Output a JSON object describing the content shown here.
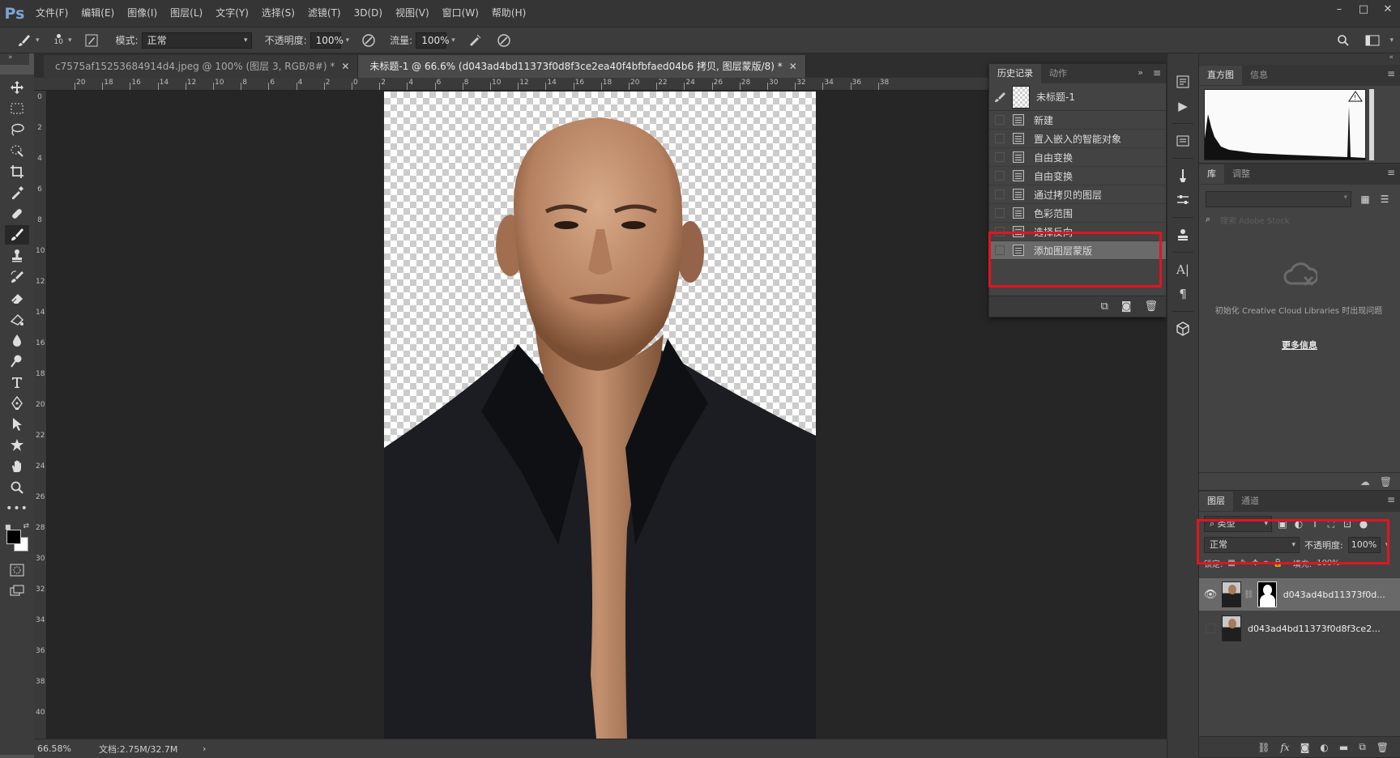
{
  "app": {
    "logo": "Ps",
    "menu": [
      "文件(F)",
      "编辑(E)",
      "图像(I)",
      "图层(L)",
      "文字(Y)",
      "选择(S)",
      "滤镜(T)",
      "3D(D)",
      "视图(V)",
      "窗口(W)",
      "帮助(H)"
    ],
    "window_controls": [
      "–",
      "□",
      "✕"
    ]
  },
  "options": {
    "brush_size": "10",
    "mode_label": "模式:",
    "mode_value": "正常",
    "opacity_label": "不透明度:",
    "opacity_value": "100%",
    "flow_label": "流量:",
    "flow_value": "100%"
  },
  "tabs": [
    {
      "title": "c7575af15253684914d4.jpeg @ 100% (图层 3, RGB/8#) *",
      "close": "✕"
    },
    {
      "title": "未标题-1 @ 66.6% (d043ad4bd11373f0d8f3ce2ea40f4bfbfaed04b6 拷贝, 图层蒙版/8) *",
      "close": "✕"
    }
  ],
  "rulers": {
    "horizontal": [
      "20",
      "18",
      "16",
      "14",
      "12",
      "10",
      "8",
      "6",
      "4",
      "2",
      "0",
      "2",
      "4",
      "6",
      "8",
      "10",
      "12",
      "14",
      "16",
      "18",
      "20",
      "22",
      "24",
      "26",
      "28",
      "30",
      "32",
      "34",
      "36",
      "38"
    ],
    "vertical": [
      "0",
      "2",
      "4",
      "6",
      "8",
      "10",
      "12",
      "14",
      "16",
      "18",
      "20",
      "22",
      "24",
      "26",
      "28",
      "30",
      "32",
      "34",
      "36",
      "38",
      "40"
    ]
  },
  "status": {
    "zoom": "66.58%",
    "doc": "文档:2.75M/32.7M",
    "arrow": "›"
  },
  "history": {
    "tabs": [
      "历史记录",
      "动作"
    ],
    "snapshot": "未标题-1",
    "items": [
      "新建",
      "置入嵌入的智能对象",
      "自由变换",
      "自由变换",
      "通过拷贝的图层",
      "色彩范围",
      "选择反向",
      "添加图层蒙版"
    ],
    "selected_index": 7
  },
  "histogram": {
    "tabs": [
      "直方图",
      "信息"
    ]
  },
  "library": {
    "tabs": [
      "库",
      "调整"
    ],
    "search_placeholder": "搜索 Adobe Stock",
    "message": "初始化 Creative Cloud Libraries 时出现问题",
    "link": "更多信息"
  },
  "layers": {
    "tabs": [
      "图层",
      "通道"
    ],
    "kind_filter": "类型",
    "blend_mode": "正常",
    "opacity_label": "不透明度:",
    "opacity_value": "100%",
    "lock_label": "锁定:",
    "fill_label": "填充:",
    "fill_value": "100%",
    "items": [
      {
        "name": "d043ad4bd11373f0d8f3ce2ea40f4bfbfaed04b6 拷贝",
        "display": "d043ad4bd11373f0d...",
        "visible": true,
        "has_mask": true
      },
      {
        "name": "d043ad4bd11373f0d8f3ce2ea40f4bfbfaed04b6",
        "display": "d043ad4bd11373f0d8f3ce2...",
        "visible": false,
        "has_mask": false
      }
    ]
  },
  "colors": {
    "highlight": "#e5131e",
    "foreground": "#000000",
    "background": "#ffffff"
  }
}
